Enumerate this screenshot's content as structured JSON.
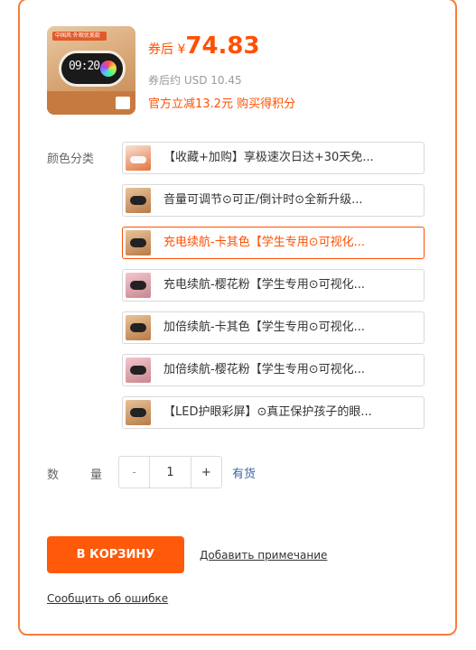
{
  "product": {
    "thumb_banner": "中国风·外观优美款",
    "thumb_time": "09:20"
  },
  "price": {
    "prefix": "券后 ¥",
    "amount": "74.83",
    "usd": "券后约 USD 10.45",
    "promo": "官方立减13.2元 购买得积分"
  },
  "variants": {
    "label": "颜色分类",
    "options": [
      {
        "label": "【收藏+加购】享极速次日达+30天免...",
        "selected": false
      },
      {
        "label": "音量可调节⊙可正/倒计时⊙全新升级...",
        "selected": false
      },
      {
        "label": "充电续航-卡其色【学生专用⊙可视化...",
        "selected": true
      },
      {
        "label": "充电续航-樱花粉【学生专用⊙可视化...",
        "selected": false
      },
      {
        "label": "加倍续航-卡其色【学生专用⊙可视化...",
        "selected": false
      },
      {
        "label": "加倍续航-樱花粉【学生专用⊙可视化...",
        "selected": false
      },
      {
        "label": "【LED护眼彩屏】⊙真正保护孩子的眼...",
        "selected": false
      }
    ]
  },
  "quantity": {
    "label_1": "数",
    "label_2": "量",
    "minus": "-",
    "value": "1",
    "plus": "+",
    "stock": "有货"
  },
  "actions": {
    "cart_button": "В КОРЗИНУ",
    "add_note": "Добавить примечание",
    "report_error": "Сообщить об ошибке"
  },
  "colors": {
    "accent": "#ff5000",
    "border": "#f97d3a",
    "link_blue": "#3c64a0"
  }
}
